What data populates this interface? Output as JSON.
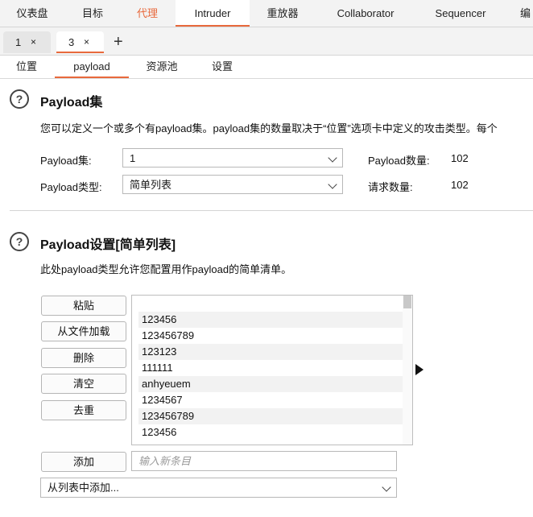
{
  "top_tabs": [
    {
      "label": "仪表盘"
    },
    {
      "label": "目标"
    },
    {
      "label": "代理"
    },
    {
      "label": "Intruder"
    },
    {
      "label": "重放器"
    },
    {
      "label": "Collaborator"
    },
    {
      "label": "Sequencer"
    },
    {
      "label": "编"
    }
  ],
  "instance_tabs": [
    {
      "label": "1",
      "close": "×"
    },
    {
      "label": "3",
      "close": "×"
    }
  ],
  "add_tab_label": "+",
  "sub_tabs": [
    {
      "label": "位置"
    },
    {
      "label": "payload"
    },
    {
      "label": "资源池"
    },
    {
      "label": "设置"
    }
  ],
  "payload_sets": {
    "help_icon": "?",
    "title": "Payload集",
    "description": "您可以定义一个或多个有payload集。payload集的数量取决于“位置”选项卡中定义的攻击类型。每个",
    "set_label": "Payload集:",
    "set_value": "1",
    "type_label": "Payload类型:",
    "type_value": "简单列表",
    "count_label": "Payload数量:",
    "count_value": "102",
    "request_label": "请求数量:",
    "request_value": "102"
  },
  "payload_settings": {
    "help_icon": "?",
    "title": "Payload设置[简单列表]",
    "description": "此处payload类型允许您配置用作payload的简单清单。",
    "buttons": {
      "paste": "粘贴",
      "load": "从文件加载",
      "remove": "删除",
      "clear": "清空",
      "dedupe": "去重",
      "add": "添加"
    },
    "items": [
      "",
      "123456",
      "123456789",
      "123123",
      "111111",
      "anhyeuem",
      "1234567",
      "123456789",
      "123456"
    ],
    "add_placeholder": "输入新条目",
    "add_from_list": "从列表中添加..."
  }
}
